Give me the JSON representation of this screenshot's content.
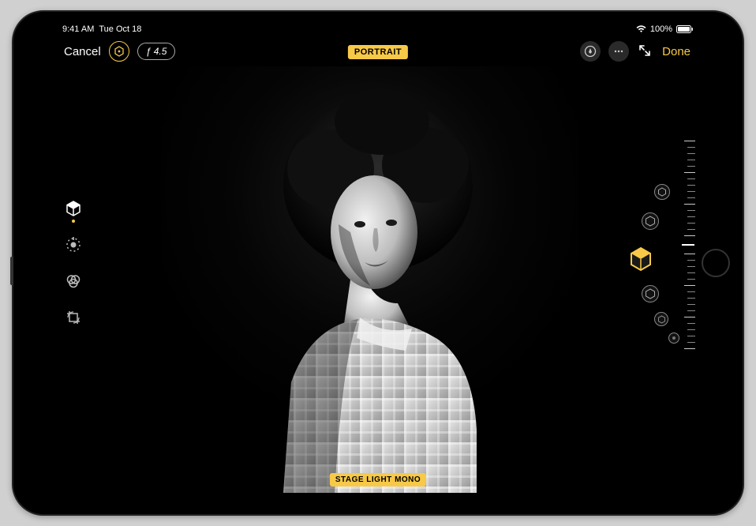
{
  "status": {
    "time": "9:41 AM",
    "date": "Tue Oct 18",
    "battery_pct": "100%"
  },
  "topbar": {
    "cancel": "Cancel",
    "f_stop": "ƒ 4.5",
    "mode_badge": "PORTRAIT",
    "done": "Done"
  },
  "effect": {
    "current_label": "STAGE LIGHT MONO"
  },
  "left_tools": {
    "portrait_lighting": "portrait-lighting",
    "adjust": "adjust",
    "filters": "filters",
    "crop": "crop"
  },
  "lighting_options": [
    "natural-light",
    "studio-light",
    "contour-light",
    "stage-light",
    "stage-light-mono",
    "high-key-mono"
  ],
  "colors": {
    "accent": "#f7c948"
  }
}
